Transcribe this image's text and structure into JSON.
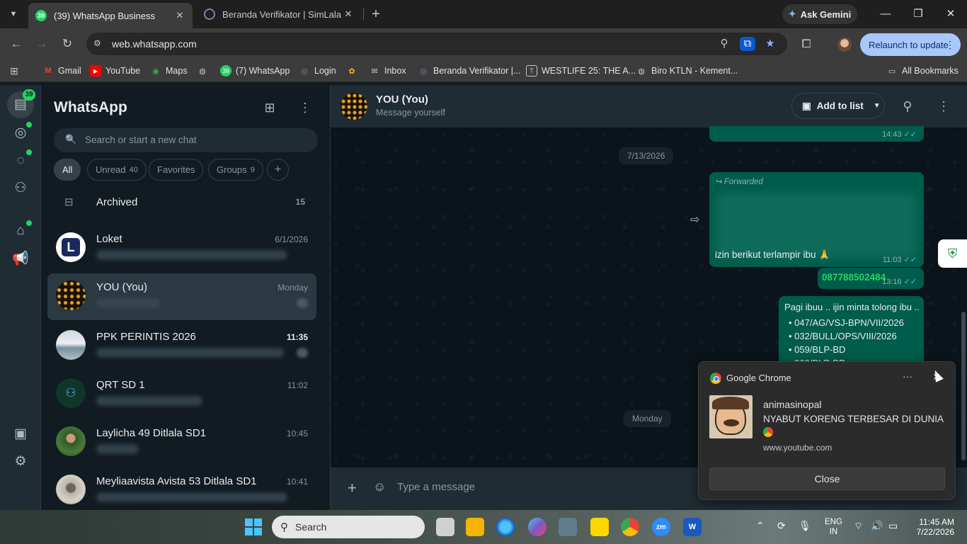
{
  "browser": {
    "tabs": [
      {
        "title": "(39) WhatsApp Business",
        "badge": "39"
      },
      {
        "title": "Beranda Verifikator | SimLala"
      }
    ],
    "gemini_label": "Ask Gemini",
    "url": "web.whatsapp.com",
    "relaunch_label": "Relaunch to update",
    "bookmarks": [
      "Gmail",
      "YouTube",
      "Maps",
      "(7) WhatsApp",
      "Login",
      "Inbox",
      "Beranda Verifikator |...",
      "WESTLIFE 25: THE A...",
      "Biro KTLN - Kement..."
    ],
    "all_bookmarks": "All Bookmarks"
  },
  "rail": {
    "chats_badge": "39"
  },
  "chatlist": {
    "title": "WhatsApp",
    "search_placeholder": "Search or start a new chat",
    "filters": [
      {
        "label": "All",
        "count": ""
      },
      {
        "label": "Unread",
        "count": "40"
      },
      {
        "label": "Favorites",
        "count": ""
      },
      {
        "label": "Groups",
        "count": "9"
      }
    ],
    "archived_label": "Archived",
    "archived_count": "15",
    "chats": [
      {
        "name": "Loket",
        "time": "6/1/2026"
      },
      {
        "name": "YOU (You)",
        "time": "Monday"
      },
      {
        "name": "PPK PERINTIS 2026",
        "time": "11:35"
      },
      {
        "name": "QRT SD 1",
        "time": "11:02"
      },
      {
        "name": "Laylicha 49 Ditlala SD1",
        "time": "10:45"
      },
      {
        "name": "Meyliaavista Avista 53 Ditlala SD1",
        "time": "10:41"
      }
    ]
  },
  "conversation": {
    "name": "YOU (You)",
    "subtitle": "Message yourself",
    "add_to_list": "Add to list",
    "date_1": "7/13/2026",
    "date_2": "Monday",
    "msg_top_time": "14:43",
    "fwd_label": "Forwarded",
    "fwd_text": "izin berikut terlampir ibu 🙏",
    "fwd_time": "11:03",
    "phone": "087788502484",
    "phone_time": "13:16",
    "long_msg": "Pagi ibuu .. ijin minta tolong ibu ..",
    "long_items": [
      "• 047/AG/VSJ-BPN/VII/2026",
      "• 032/BULL/OPS/VIII/2026",
      "• 059/BLP-BD",
      "• 060/BLP-BD"
    ],
    "composer_placeholder": "Type a message"
  },
  "notification": {
    "app": "Google Chrome",
    "title": "animasinopal",
    "body": "NYABUT KORENG TERBESAR DI DUNIA",
    "source": "www.youtube.com",
    "button": "Close"
  },
  "taskbar": {
    "search_label": "Search",
    "lang_1": "ENG",
    "lang_2": "IN",
    "time": "11:45 AM",
    "date": "7/22/2026"
  }
}
